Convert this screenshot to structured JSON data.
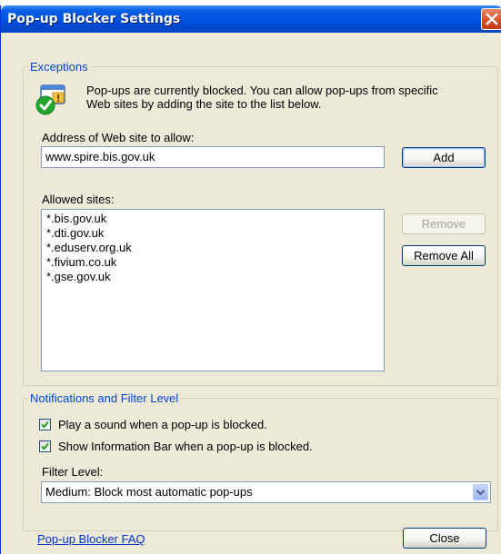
{
  "window": {
    "title": "Pop-up Blocker Settings"
  },
  "exceptions": {
    "group_label": "Exceptions",
    "info_line1": "Pop-ups are currently blocked.  You can allow pop-ups from specific",
    "info_line2": "Web sites by adding the site to the list below.",
    "address_label": "Address of Web site to allow:",
    "address_value": "www.spire.bis.gov.uk",
    "add_label": "Add",
    "allowed_label": "Allowed sites:",
    "allowed_sites": [
      "*.bis.gov.uk",
      "*.dti.gov.uk",
      "*.eduserv.org.uk",
      "*.fivium.co.uk",
      "*.gse.gov.uk"
    ],
    "remove_label": "Remove",
    "remove_all_label": "Remove All"
  },
  "notifications": {
    "group_label": "Notifications and Filter Level",
    "play_sound_label": "Play a sound when a pop-up is blocked.",
    "play_sound_checked": true,
    "show_infobar_label": "Show Information Bar when a pop-up is blocked.",
    "show_infobar_checked": true,
    "filter_label": "Filter Level:",
    "filter_value": "Medium: Block most automatic pop-ups"
  },
  "footer": {
    "faq_link": "Pop-up Blocker FAQ",
    "close_label": "Close"
  },
  "icons": {
    "close": "close-icon",
    "info": "popup-blocked-icon",
    "checkmark": "checkmark-icon",
    "dropdown": "chevron-down-icon"
  },
  "colors": {
    "title_bar": "#0054e3",
    "dialog_bg": "#ece9d8",
    "group_label": "#0046d5",
    "link": "#0033cc",
    "check_green": "#21a121"
  }
}
